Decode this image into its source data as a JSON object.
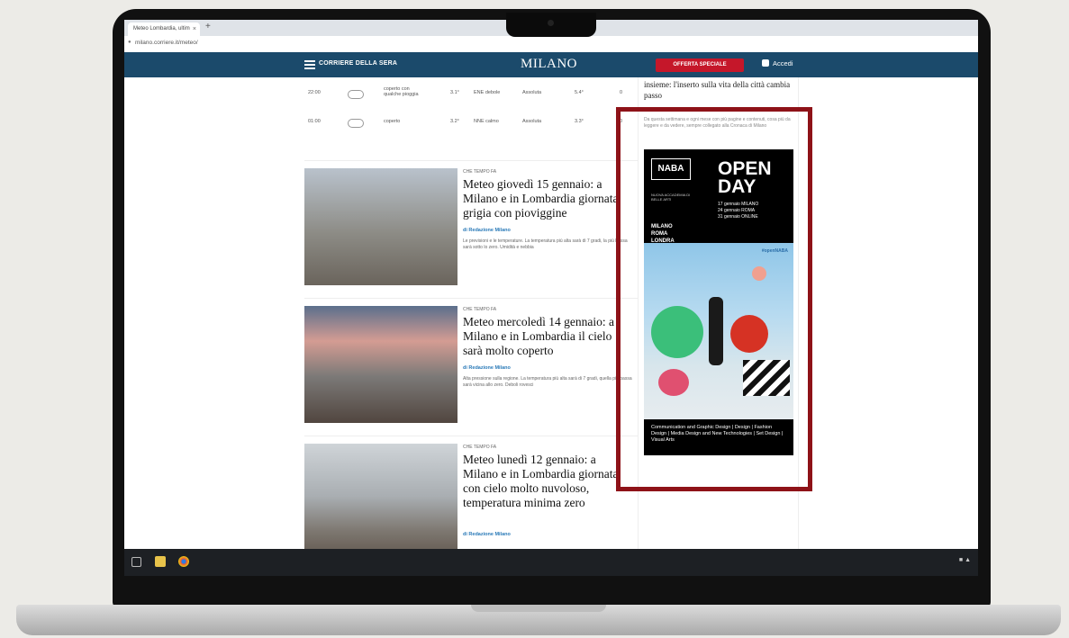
{
  "browser": {
    "tab_title": "Meteo Lombardia, ultim",
    "tab_close": "×",
    "new_tab": "+",
    "url": "milano.corriere.it/meteo/"
  },
  "header": {
    "brand": "CORRIERE DELLA SERA",
    "city": "MILANO",
    "offers_label": "OFFERTA SPECIALE",
    "login_label": "Accedi"
  },
  "weather_rows": [
    {
      "time": "22:00",
      "desc": "coperto con\nqualche pioggia",
      "temp": "3.1°",
      "wind": "ENE debole",
      "humidity": "Assoluta",
      "feels": "5.4°",
      "rain": "0"
    },
    {
      "time": "01:00",
      "desc": "coperto",
      "temp": "3.2°",
      "wind": "NNE calmo",
      "humidity": "Assoluta",
      "feels": "3.3°",
      "rain": "0"
    }
  ],
  "articles": [
    {
      "kicker": "CHE TEMPO FA",
      "headline": "Meteo giovedì 15 gennaio: a Milano e in Lombardia giornata grigia con pioviggine",
      "author": "di Redazione Milano",
      "summary": "Le previsioni e le temperature. La temperatura più alta sarà di 7 gradi, la più bassa sarà sotto lo zero. Umidità e nebbia"
    },
    {
      "kicker": "CHE TEMPO FA",
      "headline": "Meteo mercoledì 14 gennaio: a Milano e in Lombardia il cielo sarà molto coperto",
      "author": "di Redazione Milano",
      "summary": "Alta pressione sulla regione. La temperatura più alta sarà di 7 gradi, quella più bassa sarà vicina allo zero. Deboli rovesci"
    },
    {
      "kicker": "CHE TEMPO FA",
      "headline": "Meteo lunedì 12 gennaio: a Milano e in Lombardia giornata con cielo molto nuvoloso, temperatura minima zero",
      "author": "di Redazione Milano",
      "summary": ""
    }
  ],
  "sidebar": {
    "title": "insieme: l'inserto sulla vita della città cambia passo",
    "text": "Da questa settimana e ogni mese con più pagine e contenuti, cosa più da leggere e da vedere, sempre collegato alla Cronaca di Milano"
  },
  "ad": {
    "logo": "NABA",
    "logo_sub": "NUOVA ACCADEMIA DI BELLE ARTI",
    "headline_line1": "OPEN",
    "headline_line2": "DAY",
    "dates": [
      "17 gennaio   MILANO",
      "24 gennaio   ROMA",
      "31 gennaio   ONLINE"
    ],
    "cities": [
      "MILANO",
      "ROMA",
      "LONDRA"
    ],
    "tag": "#openNABA",
    "footer": "Communication and Graphic Design | Design | Fashion Design | Media Design and New Technologies | Set Design | Visual Arts"
  },
  "colors": {
    "header_bg": "#1b4a6b",
    "offer_red": "#c5172a",
    "highlight_box": "#8e1218",
    "link_blue": "#2a7ab8"
  }
}
